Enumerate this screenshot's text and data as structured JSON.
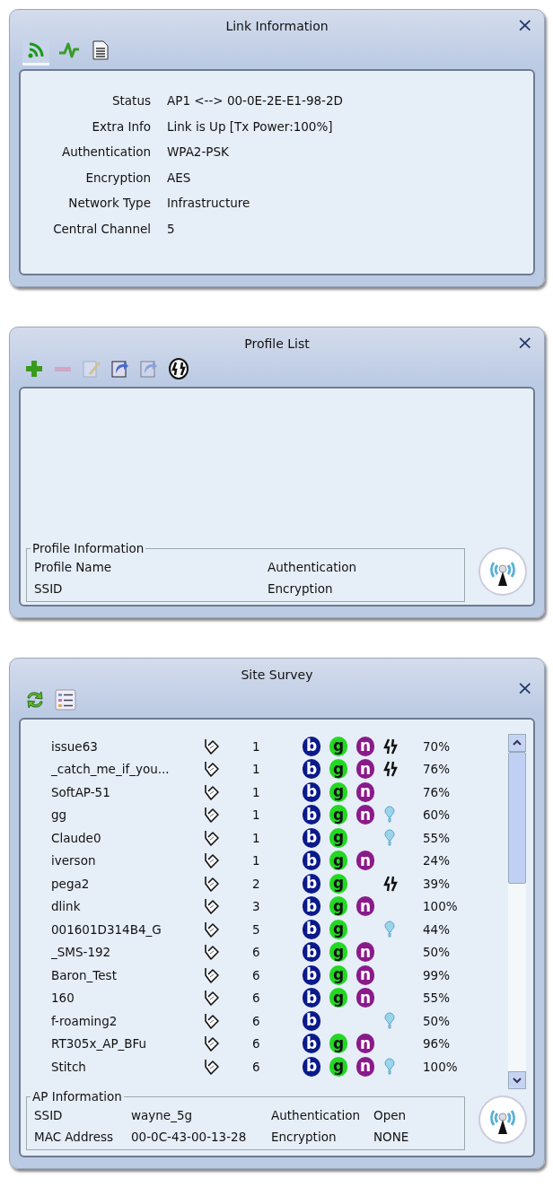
{
  "link_information": {
    "title": "Link Information",
    "close": "×",
    "tabs": [
      {
        "kind": "signal",
        "selected": true
      },
      {
        "kind": "graph",
        "selected": false
      },
      {
        "kind": "document",
        "selected": false
      }
    ],
    "fields": [
      {
        "label": "Status",
        "value": "AP1 <--> 00-0E-2E-E1-98-2D"
      },
      {
        "label": "Extra Info",
        "value": "Link is Up  [Tx Power:100%]"
      },
      {
        "label": "Authentication",
        "value": "WPA2-PSK"
      },
      {
        "label": "Encryption",
        "value": "AES"
      },
      {
        "label": "Network Type",
        "value": "Infrastructure"
      },
      {
        "label": "Central Channel",
        "value": "5"
      }
    ]
  },
  "profile_list": {
    "title": "Profile List",
    "close": "×",
    "toolbar": [
      {
        "kind": "add",
        "disabled": false
      },
      {
        "kind": "remove",
        "disabled": true
      },
      {
        "kind": "edit",
        "disabled": true
      },
      {
        "kind": "import",
        "disabled": false
      },
      {
        "kind": "export",
        "disabled": true
      },
      {
        "kind": "activate",
        "disabled": false
      }
    ],
    "profile_information": {
      "title": "Profile Information",
      "fields": [
        {
          "label": "Profile Name"
        },
        {
          "label": "Authentication"
        },
        {
          "label": "SSID"
        },
        {
          "label": "Encryption"
        }
      ]
    }
  },
  "site_survey": {
    "title": "Site Survey",
    "close": "×",
    "networks": [
      {
        "ssid": "issue63",
        "channel": "1",
        "modes": [
          {
            "kind": "b",
            "letter": "b"
          },
          {
            "kind": "g",
            "letter": "g"
          },
          {
            "kind": "n",
            "letter": "n"
          }
        ],
        "wps": true,
        "bulb": false,
        "signal": "70%"
      },
      {
        "ssid": "_catch_me_if_you...",
        "channel": "1",
        "modes": [
          {
            "kind": "b",
            "letter": "b"
          },
          {
            "kind": "g",
            "letter": "g"
          },
          {
            "kind": "n",
            "letter": "n"
          }
        ],
        "wps": true,
        "bulb": false,
        "signal": "76%"
      },
      {
        "ssid": "SoftAP-51",
        "channel": "1",
        "modes": [
          {
            "kind": "b",
            "letter": "b"
          },
          {
            "kind": "g",
            "letter": "g"
          },
          {
            "kind": "n",
            "letter": "n"
          }
        ],
        "wps": false,
        "bulb": false,
        "signal": "76%"
      },
      {
        "ssid": "gg",
        "channel": "1",
        "modes": [
          {
            "kind": "b",
            "letter": "b"
          },
          {
            "kind": "g",
            "letter": "g"
          },
          {
            "kind": "n",
            "letter": "n"
          }
        ],
        "wps": false,
        "bulb": true,
        "signal": "60%"
      },
      {
        "ssid": "Claude0",
        "channel": "1",
        "modes": [
          {
            "kind": "b",
            "letter": "b"
          },
          {
            "kind": "g",
            "letter": "g"
          }
        ],
        "wps": false,
        "bulb": true,
        "signal": "55%"
      },
      {
        "ssid": "iverson",
        "channel": "1",
        "modes": [
          {
            "kind": "b",
            "letter": "b"
          },
          {
            "kind": "g",
            "letter": "g"
          },
          {
            "kind": "n",
            "letter": "n"
          }
        ],
        "wps": false,
        "bulb": false,
        "signal": "24%"
      },
      {
        "ssid": "pega2",
        "channel": "2",
        "modes": [
          {
            "kind": "b",
            "letter": "b"
          },
          {
            "kind": "g",
            "letter": "g"
          }
        ],
        "wps": true,
        "bulb": false,
        "signal": "39%"
      },
      {
        "ssid": "dlink",
        "channel": "3",
        "modes": [
          {
            "kind": "b",
            "letter": "b"
          },
          {
            "kind": "g",
            "letter": "g"
          },
          {
            "kind": "n",
            "letter": "n"
          }
        ],
        "wps": false,
        "bulb": false,
        "signal": "100%"
      },
      {
        "ssid": "001601D314B4_G",
        "channel": "5",
        "modes": [
          {
            "kind": "b",
            "letter": "b"
          },
          {
            "kind": "g",
            "letter": "g"
          }
        ],
        "wps": false,
        "bulb": true,
        "signal": "44%"
      },
      {
        "ssid": "_SMS-192",
        "channel": "6",
        "modes": [
          {
            "kind": "b",
            "letter": "b"
          },
          {
            "kind": "g",
            "letter": "g"
          },
          {
            "kind": "n",
            "letter": "n"
          }
        ],
        "wps": false,
        "bulb": false,
        "signal": "50%"
      },
      {
        "ssid": "Baron_Test",
        "channel": "6",
        "modes": [
          {
            "kind": "b",
            "letter": "b"
          },
          {
            "kind": "g",
            "letter": "g"
          },
          {
            "kind": "n",
            "letter": "n"
          }
        ],
        "wps": false,
        "bulb": false,
        "signal": "99%"
      },
      {
        "ssid": "160",
        "channel": "6",
        "modes": [
          {
            "kind": "b",
            "letter": "b"
          },
          {
            "kind": "g",
            "letter": "g"
          },
          {
            "kind": "n",
            "letter": "n"
          }
        ],
        "wps": false,
        "bulb": false,
        "signal": "55%"
      },
      {
        "ssid": "f-roaming2",
        "channel": "6",
        "modes": [
          {
            "kind": "b",
            "letter": "b"
          }
        ],
        "wps": false,
        "bulb": true,
        "signal": "50%"
      },
      {
        "ssid": "RT305x_AP_BFu",
        "channel": "6",
        "modes": [
          {
            "kind": "b",
            "letter": "b"
          },
          {
            "kind": "g",
            "letter": "g"
          },
          {
            "kind": "n",
            "letter": "n"
          }
        ],
        "wps": false,
        "bulb": false,
        "signal": "96%"
      },
      {
        "ssid": "Stitch",
        "channel": "6",
        "modes": [
          {
            "kind": "b",
            "letter": "b"
          },
          {
            "kind": "g",
            "letter": "g"
          },
          {
            "kind": "n",
            "letter": "n"
          }
        ],
        "wps": false,
        "bulb": true,
        "signal": "100%"
      }
    ],
    "ap_information": {
      "title": "AP Information",
      "fields": [
        {
          "label": "SSID",
          "value": "wayne_5g"
        },
        {
          "label": "Authentication",
          "value": "Open"
        },
        {
          "label": "MAC Address",
          "value": "00-0C-43-00-13-28"
        },
        {
          "label": "Encryption",
          "value": "NONE"
        }
      ]
    }
  }
}
